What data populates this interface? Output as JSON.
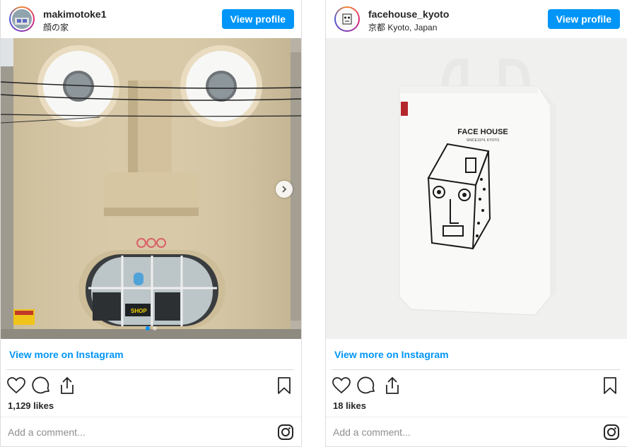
{
  "posts": [
    {
      "username": "makimotoke1",
      "location": "顔の家",
      "view_profile_label": "View profile",
      "view_more_label": "View more on Instagram",
      "likes": "1,129 likes",
      "comment_placeholder": "Add a comment...",
      "building_sign": "ooo",
      "shop_text": "SHOP",
      "carousel": {
        "slides": 2,
        "current": 1
      }
    },
    {
      "username": "facehouse_kyoto",
      "location": "京都 Kyoto, Japan",
      "view_profile_label": "View profile",
      "view_more_label": "View more on Instagram",
      "likes": "18 likes",
      "comment_placeholder": "Add a comment...",
      "bag_title": "FACE HOUSE",
      "bag_subtitle": "SINCE1974, KYOTO"
    }
  ],
  "icons": [
    "heart-icon",
    "comment-icon",
    "share-icon",
    "bookmark-icon",
    "instagram-icon",
    "chevron-right-icon"
  ],
  "colors": {
    "accent": "#0095f6",
    "border": "#dbdbdb",
    "text": "#262626",
    "placeholder": "#8e8e8e"
  }
}
